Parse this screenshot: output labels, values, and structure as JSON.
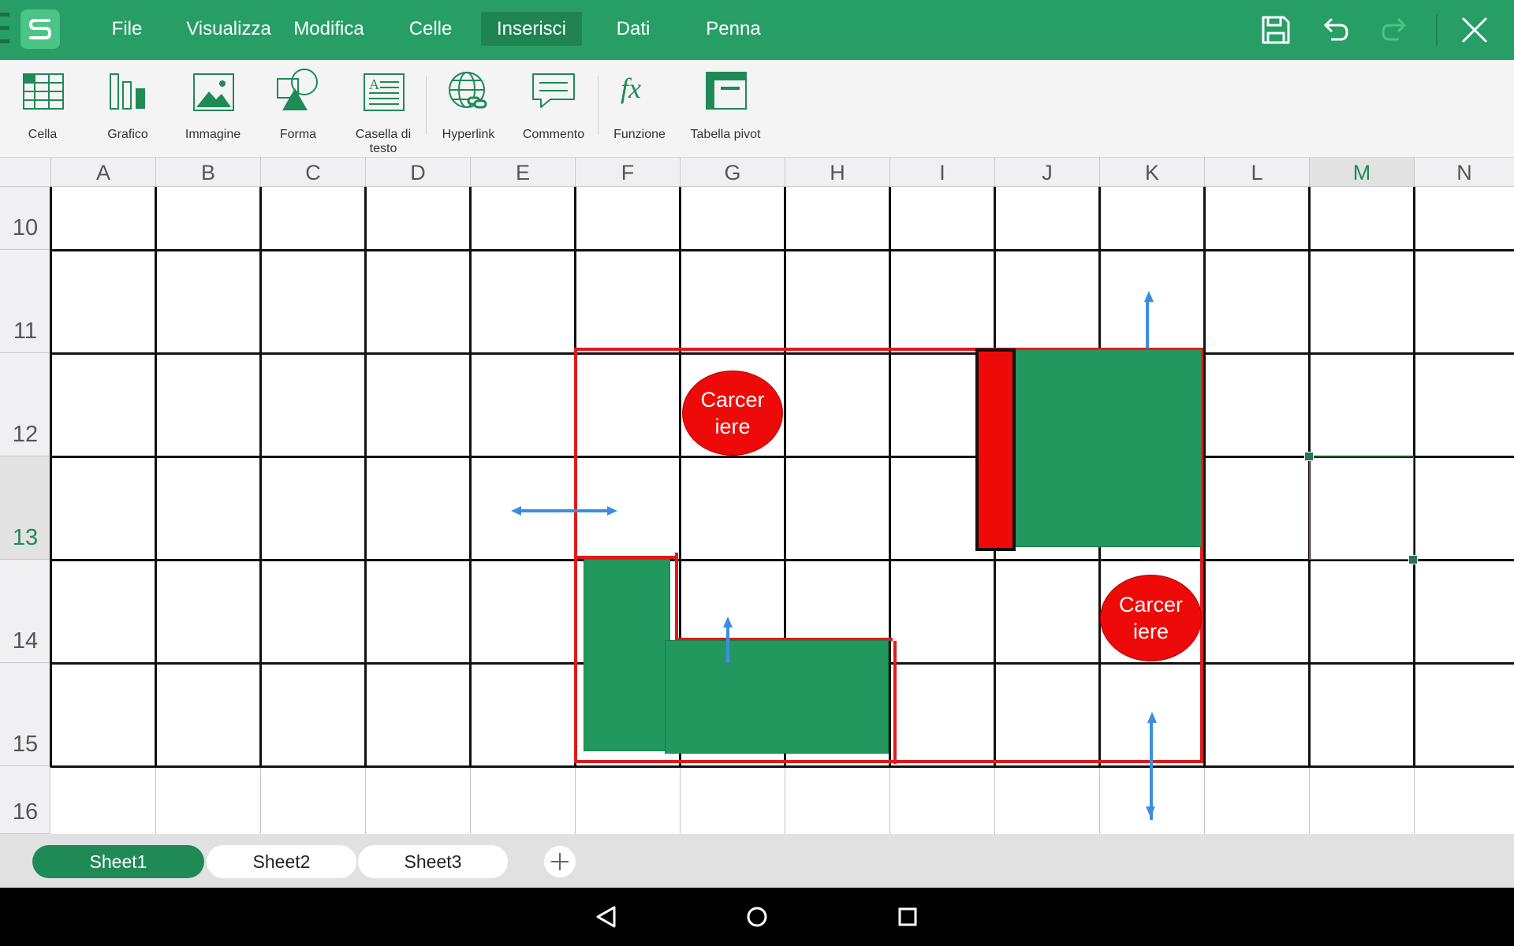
{
  "menubar": {
    "logo_letter": "S",
    "items": [
      {
        "label": "File"
      },
      {
        "label": "Visualizza"
      },
      {
        "label": "Modifica"
      },
      {
        "label": "Celle"
      },
      {
        "label": "Inserisci",
        "active": true
      },
      {
        "label": "Dati"
      },
      {
        "label": "Penna"
      }
    ],
    "toolbar_icons": [
      "save-icon",
      "undo-icon",
      "redo-icon",
      "close-icon"
    ]
  },
  "ribbon": {
    "items": [
      {
        "label": "Cella",
        "icon": "cell-table-icon"
      },
      {
        "label": "Grafico",
        "icon": "chart-icon"
      },
      {
        "label": "Immagine",
        "icon": "image-icon"
      },
      {
        "label": "Forma",
        "icon": "shape-icon"
      },
      {
        "label": "Casella di testo",
        "icon": "textbox-icon"
      },
      {
        "label": "Hyperlink",
        "icon": "hyperlink-icon"
      },
      {
        "label": "Commento",
        "icon": "comment-icon"
      },
      {
        "label": "Funzione",
        "icon": "function-icon"
      },
      {
        "label": "Tabella pivot",
        "icon": "pivot-table-icon"
      }
    ]
  },
  "grid": {
    "columns": [
      "A",
      "B",
      "C",
      "D",
      "E",
      "F",
      "G",
      "H",
      "I",
      "J",
      "K",
      "L",
      "M",
      "N"
    ],
    "rows": [
      "10",
      "11",
      "12",
      "13",
      "14",
      "15",
      "16"
    ],
    "selected_column": "M",
    "selected_row": "13"
  },
  "shapes": {
    "ellipse_1_text": "Carcer\niere",
    "ellipse_2_text": "Carcer\niere"
  },
  "sheets": {
    "tabs": [
      {
        "label": "Sheet1",
        "active": true
      },
      {
        "label": "Sheet2"
      },
      {
        "label": "Sheet3"
      }
    ],
    "add_icon": "plus-icon"
  },
  "colors": {
    "brand_green": "#279e65",
    "shape_green": "#22985e",
    "shape_red": "#ef0a0a",
    "arrow_blue": "#3d8ee0"
  }
}
